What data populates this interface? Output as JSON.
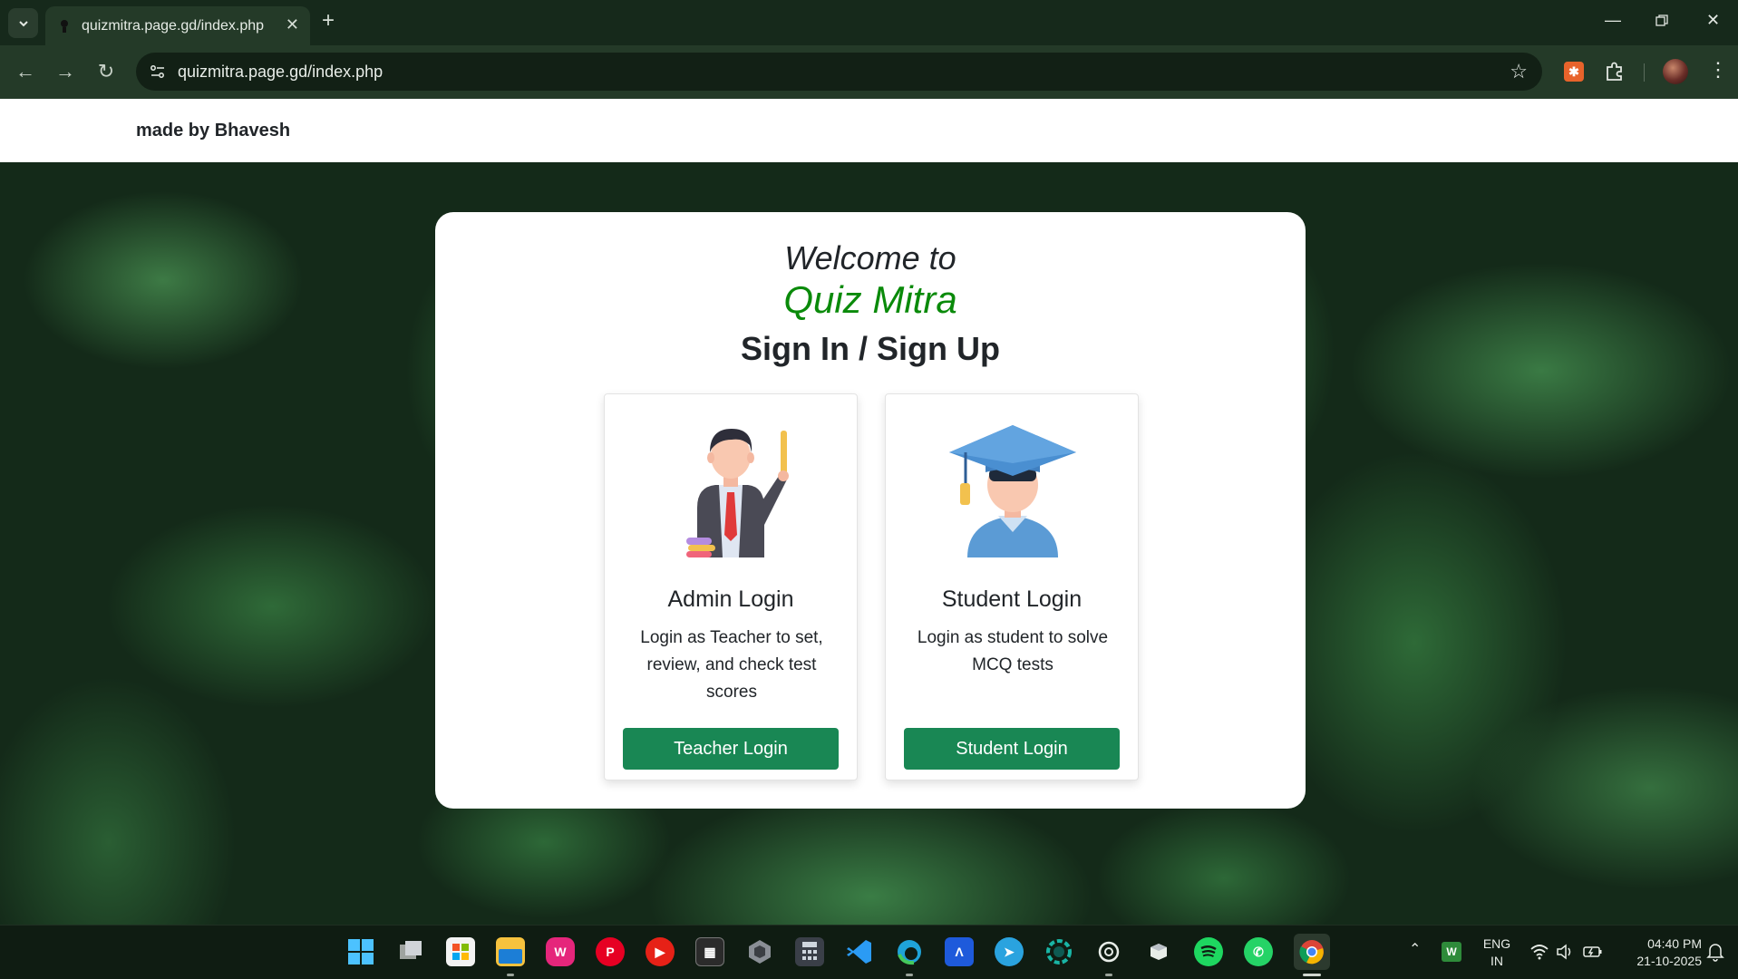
{
  "browser": {
    "tab_title": "quizmitra.page.gd/index.php",
    "url": "quizmitra.page.gd/index.php"
  },
  "page": {
    "brand": "made by Bhavesh",
    "welcome": "Welcome to",
    "app_name": "Quiz Mitra",
    "subtitle": "Sign In / Sign Up",
    "cards": [
      {
        "title": "Admin Login",
        "description": "Login as Teacher to set, review, and check test scores",
        "button": "Teacher Login",
        "illustration": "teacher-icon"
      },
      {
        "title": "Student Login",
        "description": "Login as student to solve MCQ tests",
        "button": "Student Login",
        "illustration": "graduate-student-icon"
      }
    ]
  },
  "taskbar": {
    "apps": [
      "start",
      "task-view",
      "microsoft-store",
      "file-explorer",
      "wamp",
      "pinterest",
      "youtube",
      "terminal",
      "unity",
      "calculator",
      "vscode",
      "edge",
      "app-a",
      "telegram",
      "app-ring",
      "chatgpt",
      "app-box",
      "spotify",
      "whatsapp",
      "chrome"
    ],
    "language_line1": "ENG",
    "language_line2": "IN",
    "time": "04:40 PM",
    "date": "21-10-2025"
  },
  "colors": {
    "accent_green": "#198754",
    "title_green": "#0a8a0a",
    "chrome_bg": "#243a28"
  }
}
